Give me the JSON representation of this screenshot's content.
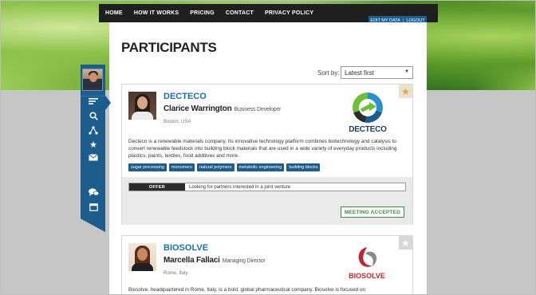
{
  "nav": {
    "items": [
      "HOME",
      "HOW IT WORKS",
      "PRICING",
      "CONTACT",
      "PRIVACY POLICY"
    ],
    "edit_my_data": "EDIT MY DATA",
    "separator": "|",
    "logout": "LOGOUT"
  },
  "page": {
    "title": "PARTICIPANTS",
    "sort_label": "Sort by:",
    "sort_value": "Latest first"
  },
  "sidebar": {
    "icons": [
      "list-icon",
      "search-icon",
      "network-icon",
      "star-icon",
      "mail-icon",
      "chat-icon",
      "calendar-icon"
    ]
  },
  "participants": [
    {
      "company": "DECTECO",
      "name": "Clarice Warrington",
      "role": "Business Developer",
      "location": "Boston, USA",
      "logo_text": "DECTECO",
      "favorite": true,
      "description": "Decteco is a renewable materials company. Its innovative technology platform combines biotechnology and catalysis to convert renewable feedstock into building block materials that are used in a wide variety of everyday products including plastics, paints, textiles, food additives and more.",
      "tags": [
        "sugar processing",
        "monomers",
        "natural polymers",
        "metabolic engineering",
        "building blocks"
      ],
      "offer_label": "OFFER",
      "offer_text": "Looking for partners interested in a joint venture",
      "status": "MEETING ACCEPTED"
    },
    {
      "company": "BIOSOLVE",
      "name": "Marcella Fallaci",
      "role": "Managing Director",
      "location": "Rome, Italy",
      "logo_text": "BIOSOLVE",
      "favorite": false,
      "description": "Biosolve, headquartered in Rome, Italy, is a bold, global pharmaceutical company. Biosolve is focused on"
    }
  ],
  "colors": {
    "accent_blue": "#1c5d8e",
    "link_blue": "#1c6fa8",
    "status_green": "#3f8a3a",
    "star_orange": "#f2a12b"
  }
}
